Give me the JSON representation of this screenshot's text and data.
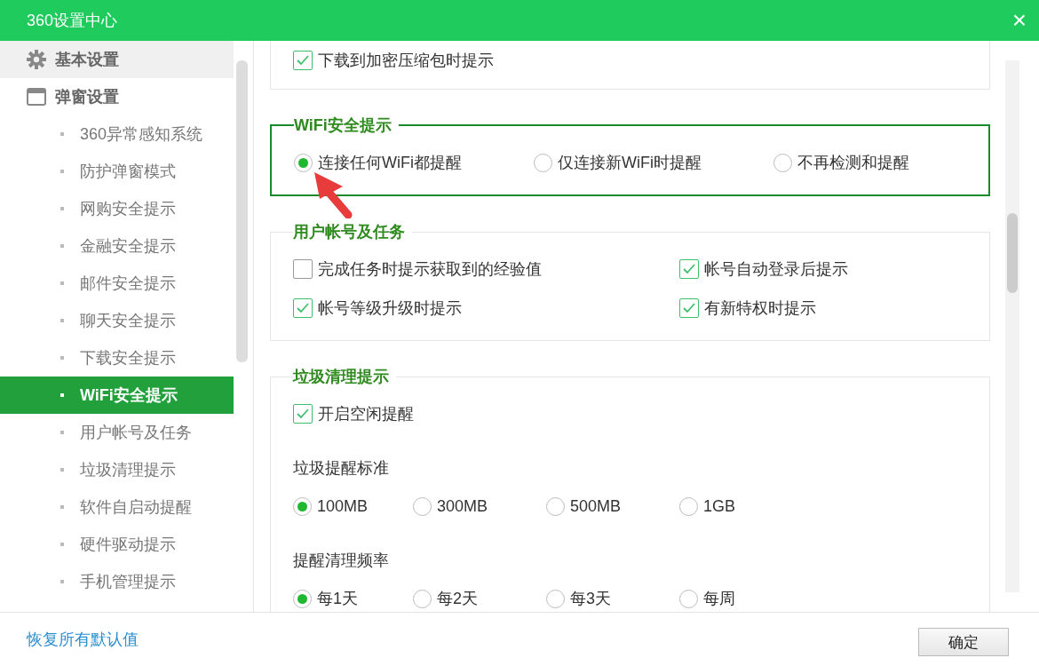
{
  "window": {
    "title": "360设置中心",
    "close": "×"
  },
  "sidebar": {
    "items": [
      {
        "label": "基本设置",
        "hovered": true
      },
      {
        "label": "弹窗设置",
        "hovered": false,
        "children": [
          {
            "label": "360异常感知系统",
            "selected": false
          },
          {
            "label": "防护弹窗模式",
            "selected": false
          },
          {
            "label": "网购安全提示",
            "selected": false
          },
          {
            "label": "金融安全提示",
            "selected": false
          },
          {
            "label": "邮件安全提示",
            "selected": false
          },
          {
            "label": "聊天安全提示",
            "selected": false
          },
          {
            "label": "下载安全提示",
            "selected": false
          },
          {
            "label": "WiFi安全提示",
            "selected": true
          },
          {
            "label": "用户帐号及任务",
            "selected": false
          },
          {
            "label": "垃圾清理提示",
            "selected": false
          },
          {
            "label": "软件自启动提醒",
            "selected": false
          },
          {
            "label": "硬件驱动提示",
            "selected": false
          },
          {
            "label": "手机管理提示",
            "selected": false
          }
        ]
      }
    ]
  },
  "sections": [
    {
      "highlighted": false,
      "rows": [
        [
          {
            "kind": "checkbox",
            "label": "下载到加密压缩包时提示",
            "checked": true
          }
        ]
      ]
    },
    {
      "title": "WiFi安全提示",
      "highlighted": true,
      "rows": [
        [
          {
            "kind": "radio",
            "label": "连接任何WiFi都提醒",
            "selected": true
          },
          {
            "kind": "radio",
            "label": "仅连接新WiFi时提醒",
            "selected": false
          },
          {
            "kind": "radio",
            "label": "不再检测和提醒",
            "selected": false
          }
        ]
      ]
    },
    {
      "title": "用户帐号及任务",
      "highlighted": false,
      "rows": [
        [
          {
            "kind": "checkbox",
            "label": "完成任务时提示获取到的经验值",
            "checked": false
          },
          {
            "kind": "checkbox",
            "label": "帐号自动登录后提示",
            "checked": true
          }
        ],
        [
          {
            "kind": "checkbox",
            "label": "帐号等级升级时提示",
            "checked": true
          },
          {
            "kind": "checkbox",
            "label": "有新特权时提示",
            "checked": true
          }
        ]
      ]
    },
    {
      "title": "垃圾清理提示",
      "highlighted": false,
      "rows": [
        [
          {
            "kind": "checkbox",
            "label": "开启空闲提醒",
            "checked": true
          }
        ],
        [
          {
            "kind": "label",
            "label": "垃圾提醒标准"
          }
        ],
        [
          {
            "kind": "radio",
            "label": "100MB",
            "selected": true
          },
          {
            "kind": "radio",
            "label": "300MB",
            "selected": false
          },
          {
            "kind": "radio",
            "label": "500MB",
            "selected": false
          },
          {
            "kind": "radio",
            "label": "1GB",
            "selected": false
          }
        ],
        [
          {
            "kind": "label",
            "label": "提醒清理频率"
          }
        ],
        [
          {
            "kind": "radio",
            "label": "每1天",
            "selected": true
          },
          {
            "kind": "radio",
            "label": "每2天",
            "selected": false
          },
          {
            "kind": "radio",
            "label": "每3天",
            "selected": false
          },
          {
            "kind": "radio",
            "label": "每周",
            "selected": false
          }
        ]
      ]
    }
  ],
  "footer": {
    "link": "恢复所有默认值",
    "button": "确定"
  }
}
